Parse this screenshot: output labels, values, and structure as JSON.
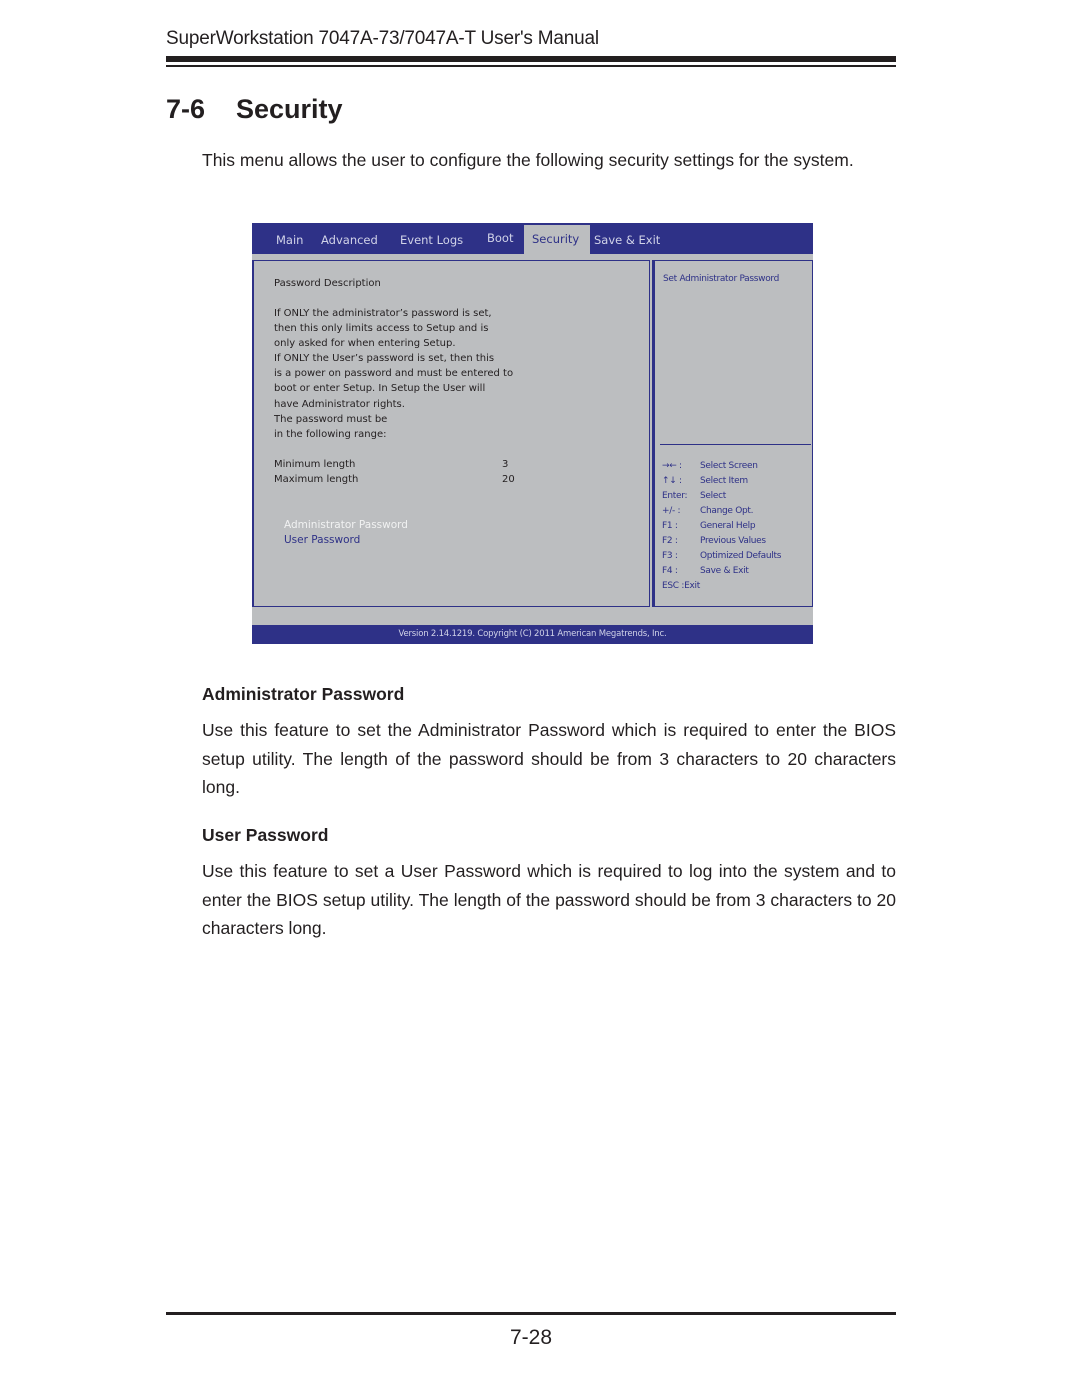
{
  "header": {
    "manual_title": "SuperWorkstation 7047A-73/7047A-T User's Manual"
  },
  "section": {
    "number": "7-6",
    "title": "Security",
    "intro": "This menu allows the user to configure the following security settings for the system."
  },
  "bios": {
    "tabs": [
      {
        "label": "Main",
        "active": false
      },
      {
        "label": "Advanced",
        "active": false
      },
      {
        "label": "Event Logs",
        "active": false
      },
      {
        "label": "Boot",
        "active": false
      },
      {
        "label": "Security",
        "active": true
      },
      {
        "label": "Save & Exit",
        "active": false
      }
    ],
    "description_heading": "Password Description",
    "description_lines": [
      "If ONLY the administrator’s password is set,",
      "then this only limits access to Setup and is",
      "only asked for when entering Setup.",
      "If ONLY the User’s password is set, then this",
      "is a power on password and must be entered to",
      "boot or enter Setup.  In Setup the User will",
      "have Administrator rights.",
      "The password must be",
      "in the following range:"
    ],
    "settings": [
      {
        "label": "Minimum length",
        "value": "3"
      },
      {
        "label": "Maximum length",
        "value": "20"
      }
    ],
    "menu_items": [
      {
        "label": "Administrator Password",
        "selected": true
      },
      {
        "label": "User Password",
        "selected": false
      }
    ],
    "help_text": "Set Administrator Password",
    "key_legend": [
      {
        "key": "→← :",
        "action": "Select Screen"
      },
      {
        "key": "↑↓  :",
        "action": "Select Item"
      },
      {
        "key": "Enter:",
        "action": "Select"
      },
      {
        "key": "+/-  :",
        "action": "Change Opt."
      },
      {
        "key": "F1 :",
        "action": "General Help"
      },
      {
        "key": "F2 :",
        "action": "Previous Values"
      },
      {
        "key": "F3 :",
        "action": "Optimized Defaults"
      },
      {
        "key": "F4 :",
        "action": "Save & Exit"
      },
      {
        "key": "ESC :Exit",
        "action": ""
      }
    ],
    "footer": "Version 2.14.1219. Copyright (C) 2011 American Megatrends, Inc.",
    "colors": {
      "bar": "#2e3187",
      "panel": "#bcbec0",
      "accent_text": "#2e3187",
      "selected_text": "#f1f2f2"
    }
  },
  "admin_password": {
    "heading": "Administrator Password",
    "body": "Use this feature to set the Administrator Password which is required to enter the BIOS setup utility. The length of the password should be from 3 characters to 20 characters long."
  },
  "user_password": {
    "heading": "User Password",
    "body": "Use this feature to set a User Password which is required to log into the system and to enter the BIOS setup utility. The length of the password should be from 3 characters to 20 characters long."
  },
  "footer": {
    "page_number": "7-28"
  }
}
